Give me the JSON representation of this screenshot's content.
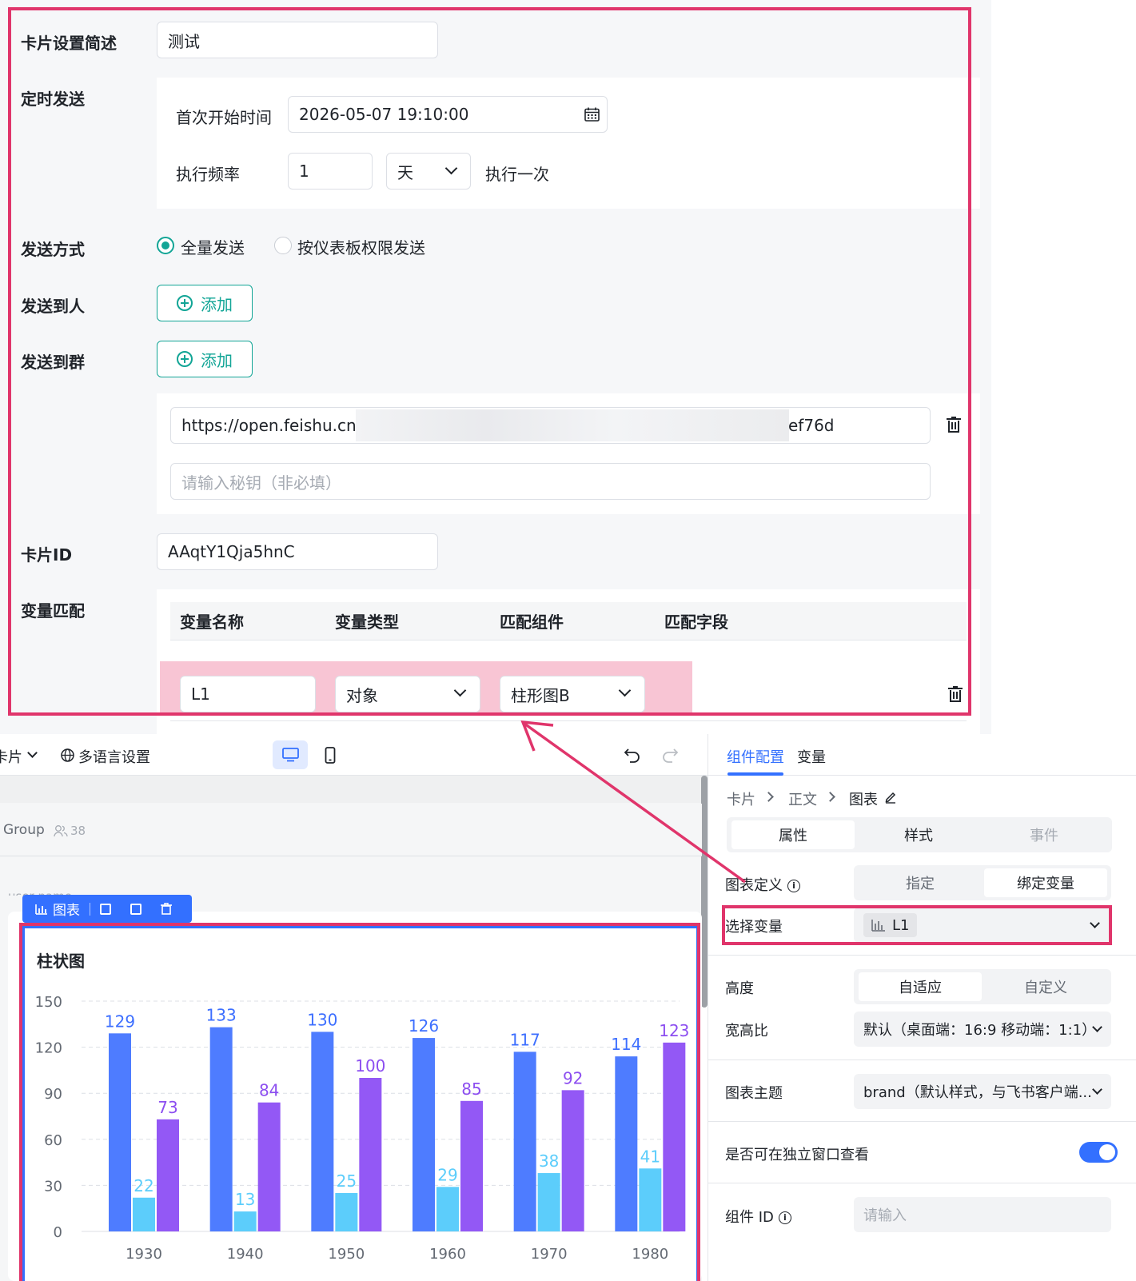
{
  "form": {
    "card_desc_label": "卡片设置简述",
    "card_desc_value": "测试",
    "schedule_label": "定时发送",
    "first_time_label": "首次开始时间",
    "first_time_value": "2026-05-07 19:10:00",
    "freq_label": "执行频率",
    "freq_value": "1",
    "freq_unit": "天",
    "freq_suffix": "执行一次",
    "send_mode_label": "发送方式",
    "send_mode_options": [
      "全量发送",
      "按仪表板权限发送"
    ],
    "send_mode_selected": "全量发送",
    "send_person_label": "发送到人",
    "send_group_label": "发送到群",
    "add_label": "添加",
    "webhook_prefix": "https://open.feishu.cn/o",
    "webhook_suffix": "ef76d",
    "secret_placeholder": "请输入秘钥（非必填）",
    "card_id_label": "卡片ID",
    "card_id_value": "AAqtY1Qja5hnC",
    "var_match_label": "变量匹配",
    "table_headers": [
      "变量名称",
      "变量类型",
      "匹配组件",
      "匹配字段"
    ],
    "row": {
      "name": "L1",
      "type": "对象",
      "component": "柱形图B"
    }
  },
  "editor": {
    "card_menu": "卡片",
    "lang_settings": "多语言设置",
    "group_name": "Group",
    "member_count": "38",
    "user_name_partial": "user name",
    "chart_toolbar_label": "图表"
  },
  "config": {
    "tabs": [
      "组件配置",
      "变量"
    ],
    "active_tab": "组件配置",
    "breadcrumb": [
      "卡片",
      "正文",
      "图表"
    ],
    "segments": [
      "属性",
      "样式",
      "事件"
    ],
    "chart_def_label": "图表定义",
    "chart_def_options": [
      "指定",
      "绑定变量"
    ],
    "chart_def_selected": "绑定变量",
    "select_var_label": "选择变量",
    "select_var_value": "L1",
    "height_label": "高度",
    "height_options": [
      "自适应",
      "自定义"
    ],
    "height_selected": "自适应",
    "ratio_label": "宽高比",
    "ratio_value": "默认（桌面端：16:9 移动端：1:1）",
    "theme_label": "图表主题",
    "theme_value": "brand（默认样式，与飞书客户端...",
    "standalone_label": "是否可在独立窗口查看",
    "standalone_on": true,
    "component_id_label": "组件 ID",
    "component_id_placeholder": "请输入"
  },
  "colors": {
    "accent_teal": "#12a596",
    "highlight_pink": "#e0356b",
    "brand_blue": "#3370ff",
    "row_highlight": "#f8c5d4",
    "series_blue": "#4e7cff",
    "series_cyan": "#5ccdfb",
    "series_purple": "#9358f5"
  },
  "chart_data": {
    "type": "bar",
    "title": "柱状图",
    "categories": [
      "1930",
      "1940",
      "1950",
      "1960",
      "1970",
      "1980"
    ],
    "series": [
      {
        "values": [
          129,
          133,
          130,
          126,
          117,
          114
        ]
      },
      {
        "values": [
          22,
          13,
          25,
          29,
          38,
          41
        ]
      },
      {
        "values": [
          73,
          84,
          100,
          85,
          92,
          123
        ]
      }
    ],
    "yticks": [
      0,
      30,
      60,
      90,
      120,
      150
    ],
    "ylim": [
      0,
      150
    ],
    "grid": true
  }
}
